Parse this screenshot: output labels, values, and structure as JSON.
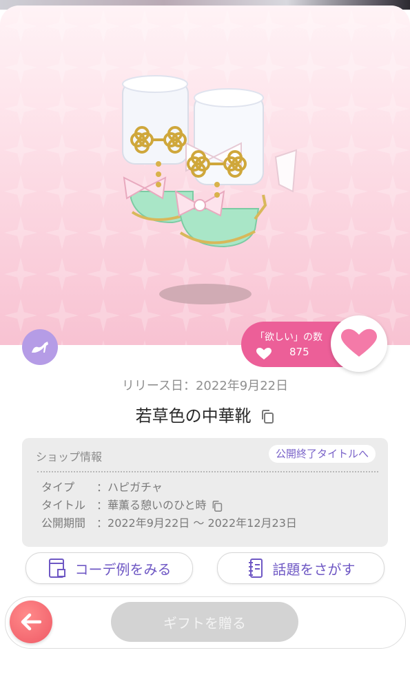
{
  "item": {
    "name": "若草色の中華靴",
    "release": "リリース日：2022年9月22日",
    "category_icon": "shoe-icon"
  },
  "want": {
    "label": "「欲しい」の数",
    "count": "875"
  },
  "shop": {
    "title": "ショップ情報",
    "ended_link": "公開終了タイトルへ",
    "rows": [
      {
        "key": "タイプ",
        "sep": "：",
        "value": "ハピガチャ"
      },
      {
        "key": "タイトル",
        "sep": "：",
        "value": "華薫る憩いのひと時"
      },
      {
        "key": "公開期間",
        "sep": "：",
        "value": "2022年9月22日 〜 2022年12月23日"
      }
    ]
  },
  "actions": {
    "coord_label": "コーデ例をみる",
    "topic_label": "話題をさがす",
    "gift_label": "ギフトを贈る"
  },
  "colors": {
    "accent_purple": "#6e57c4",
    "want_pink": "#ec5f98",
    "back_red": "#ef5a66",
    "category_lavender": "#b59ce6"
  }
}
